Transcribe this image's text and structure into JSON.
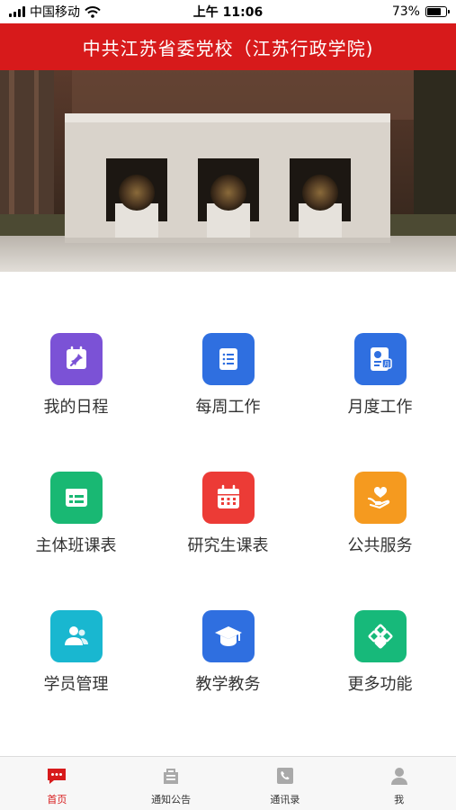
{
  "status_bar": {
    "carrier": "中国移动",
    "time": "上午 11:06",
    "battery": "73%",
    "battery_level": 0.73
  },
  "header": {
    "title": "中共江苏省委党校（江苏行政学院)"
  },
  "grid": [
    {
      "label": "我的日程",
      "icon": "schedule-pin-icon",
      "color": "#7b52d6"
    },
    {
      "label": "每周工作",
      "icon": "weekly-list-icon",
      "color": "#2f6fe0"
    },
    {
      "label": "月度工作",
      "icon": "monthly-document-icon",
      "color": "#2f6fe0"
    },
    {
      "label": "主体班课表",
      "icon": "class-table-icon",
      "color": "#19b873"
    },
    {
      "label": "研究生课表",
      "icon": "calendar-icon",
      "color": "#ec3b36"
    },
    {
      "label": "公共服务",
      "icon": "hand-heart-icon",
      "color": "#f59a1f"
    },
    {
      "label": "学员管理",
      "icon": "users-icon",
      "color": "#19b7d0"
    },
    {
      "label": "教学教务",
      "icon": "graduation-cap-icon",
      "color": "#2f6fe0"
    },
    {
      "label": "更多功能",
      "icon": "more-diamond-icon",
      "color": "#17b97a"
    }
  ],
  "tabs": [
    {
      "label": "首页",
      "icon": "home-chat-icon",
      "active": true
    },
    {
      "label": "通知公告",
      "icon": "notice-icon",
      "active": false
    },
    {
      "label": "通讯录",
      "icon": "phone-book-icon",
      "active": false
    },
    {
      "label": "我",
      "icon": "profile-icon",
      "active": false
    }
  ]
}
